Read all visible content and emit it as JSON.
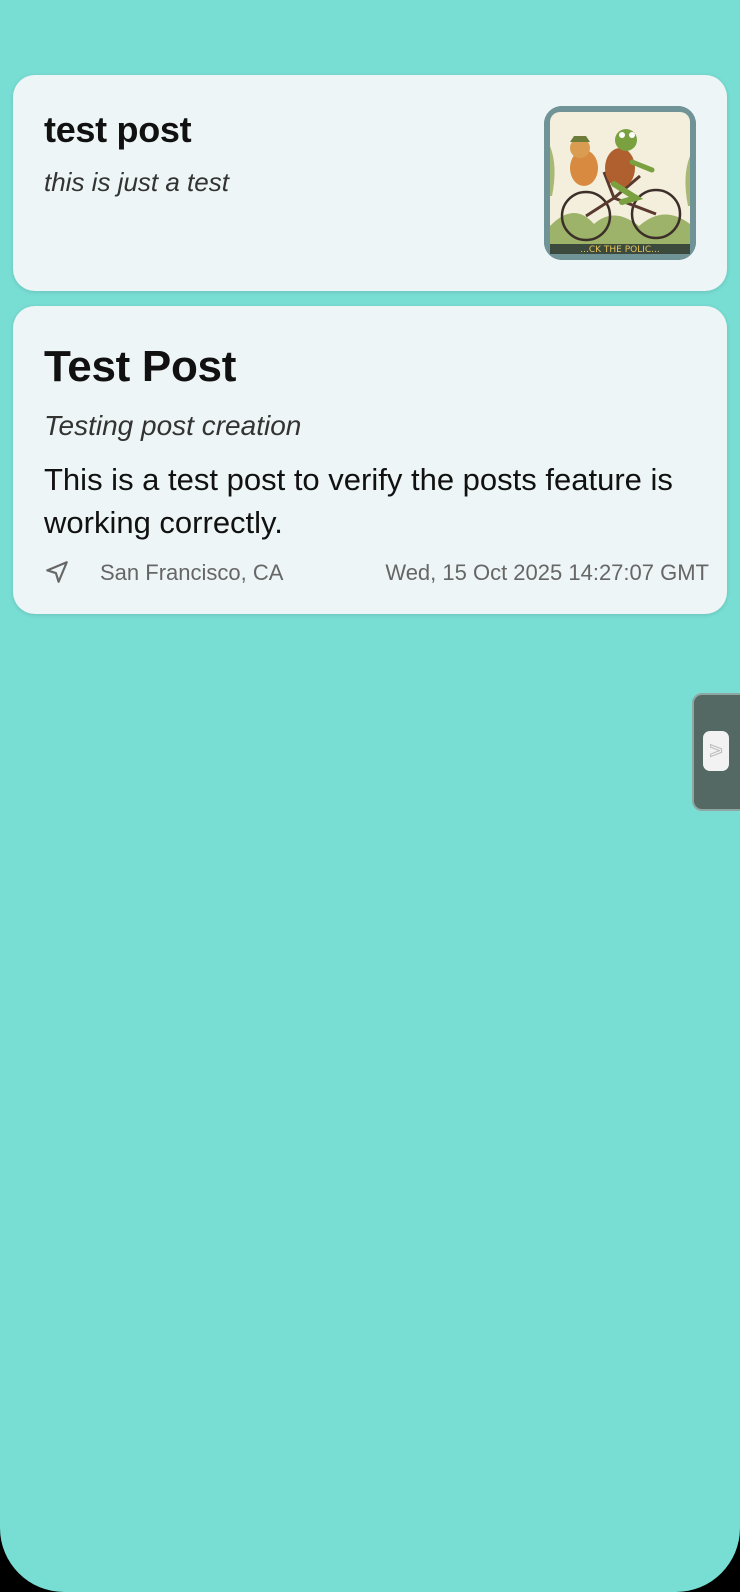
{
  "posts": [
    {
      "title": "test post",
      "subtitle": "this is just a test",
      "thumbnail_icon": "frog-and-toad-bicycle-image",
      "thumbnail_caption": "...CK THE POLIC..."
    },
    {
      "title": "Test Post",
      "subtitle": "Testing post creation",
      "body": "This is a test post to verify the posts feature is working correctly.",
      "location_icon": "location-arrow-icon",
      "location": "San Francisco, CA",
      "date": "Wed, 15 Oct 2025 14:27:07 GMT"
    }
  ],
  "side_tab": {
    "handle_label": ">"
  },
  "colors": {
    "background": "#78ddd3",
    "card": "#edf5f6",
    "side_tab": "#546864"
  }
}
